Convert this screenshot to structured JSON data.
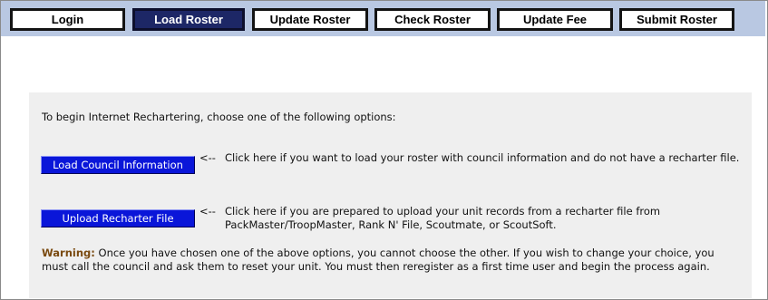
{
  "tabs": [
    {
      "label": "Login",
      "active": false
    },
    {
      "label": "Load Roster",
      "active": true
    },
    {
      "label": "Update Roster",
      "active": false
    },
    {
      "label": "Check Roster",
      "active": false
    },
    {
      "label": "Update Fee",
      "active": false
    },
    {
      "label": "Submit Roster",
      "active": false
    }
  ],
  "content": {
    "intro": "To begin Internet Rechartering, choose one of the following options:",
    "options": [
      {
        "button_label": "Load Council Information",
        "arrow": "<--",
        "description": "Click here if you want to load your roster with council information and do not have a recharter file."
      },
      {
        "button_label": "Upload Recharter File",
        "arrow": "<--",
        "description": "Click here if you are prepared to upload your unit records from a recharter file from PackMaster/TroopMaster, Rank N' File, Scoutmate, or ScoutSoft."
      }
    ],
    "warning_label": "Warning:",
    "warning_text": "Once you have chosen one of the above options, you cannot choose the other. If you wish to change your choice, you must call the council and ask them to reset your unit. You must then reregister as a first time user and begin the process again."
  },
  "colors": {
    "tab_bar": "#b9c8e2",
    "active_tab": "#1d2766",
    "button_blue": "#0a16d9",
    "panel": "#efefef",
    "warning_label": "#7a4a10"
  }
}
